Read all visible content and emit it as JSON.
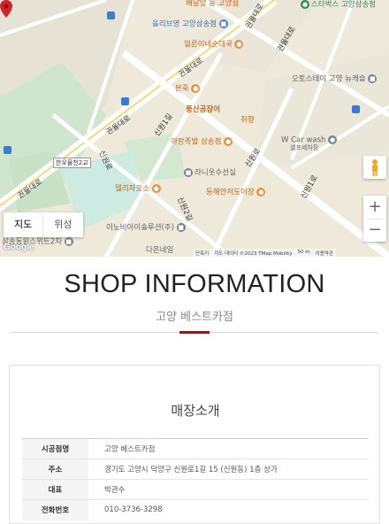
{
  "map": {
    "map_type_buttons": [
      "지도",
      "위성"
    ],
    "zoom_in": "+",
    "zoom_out": "−",
    "google_logo": "Google",
    "attribution": [
      "단축키",
      "지도 데이터 ©2023 TMap Mobility",
      "50 m",
      "이용약관"
    ],
    "pois": [
      {
        "label": "올리브영 고양삼송점",
        "color": "blue",
        "icon": "shopping-bag-icon"
      },
      {
        "label": "열른이네순대국",
        "color": "orange",
        "icon": "restaurant-icon"
      },
      {
        "label": "본죽",
        "color": "orange",
        "icon": "restaurant-icon"
      },
      {
        "label": "풍산곰장어",
        "color": "orange",
        "icon": "restaurant-icon"
      },
      {
        "label": "취향",
        "color": "orange",
        "icon": "restaurant-icon"
      },
      {
        "label": "아랑족발 삼송점",
        "color": "orange",
        "icon": "restaurant-icon"
      },
      {
        "label": "오토스테이 고양 뉴캐슬",
        "color": "gray",
        "icon": "car-icon"
      },
      {
        "label": "W Car wash",
        "color": "gray",
        "icon": "car-wash-icon"
      },
      {
        "label": "셀프세차장",
        "color": "gray",
        "icon": "car-wash-icon"
      },
      {
        "label": "라니옷수선실",
        "color": "gray",
        "icon": "shop-icon"
      },
      {
        "label": "델리자오소",
        "color": "orange",
        "icon": "restaurant-icon"
      },
      {
        "label": "동해안저도어장",
        "color": "orange",
        "icon": "restaurant-icon"
      },
      {
        "label": "이노비아이솔루션(주)",
        "color": "gray",
        "icon": "building-icon"
      },
      {
        "label": "삼송동원스위트2차",
        "color": "gray",
        "icon": "apartment-icon"
      },
      {
        "label": "다온네일",
        "color": "gray",
        "icon": "shop-icon"
      },
      {
        "label": "스타벅스 고양삼송점",
        "color": "green",
        "icon": "cafe-icon"
      }
    ],
    "roads": [
      "권율대로",
      "권율대로",
      "권율대로",
      "권율대로",
      "신원1길",
      "신원로",
      "신원2길",
      "신원로",
      "신원1로",
      "권율대로",
      "한우물천2교"
    ],
    "top_clip": "배달양 동 고양점"
  },
  "shop": {
    "title": "SHOP INFORMATION",
    "subtitle": "고양 베스트카점",
    "section_title": "매장소개",
    "rows": [
      {
        "key": "시공점명",
        "value": "고양 베스트카점"
      },
      {
        "key": "주소",
        "value": "경기도 고양시 덕양구 신원로1길 15 (신원동) 1층 상가"
      },
      {
        "key": "대표",
        "value": "박관수"
      },
      {
        "key": "전화번호",
        "value": "010-3736-3298"
      }
    ]
  },
  "colors": {
    "accent": "#8b1a1a",
    "pin": "#d2232a"
  }
}
